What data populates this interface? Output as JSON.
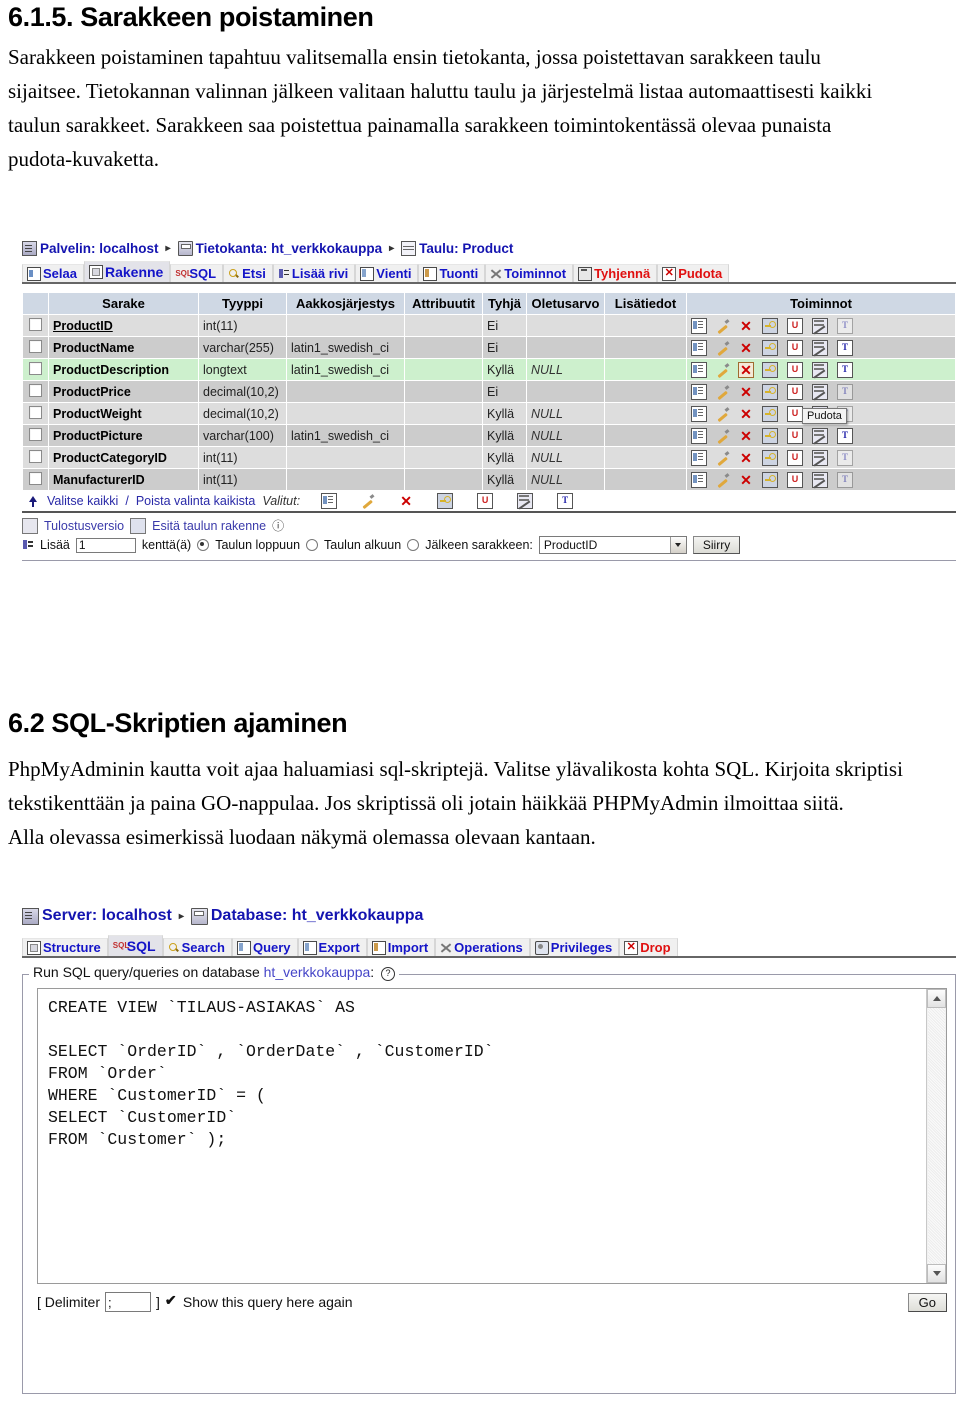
{
  "doc": {
    "section_615": {
      "heading": "6.1.5. Sarakkeen poistaminen",
      "body": "Sarakkeen poistaminen tapahtuu valitsemalla ensin tietokanta, jossa poistettavan sarakkeen taulu sijaitsee. Tietokannan valinnan jälkeen valitaan haluttu taulu ja järjestelmä listaa automaattisesti kaikki taulun sarakkeet. Sarakkeen saa poistettua painamalla sarakkeen toimintokentässä olevaa punaista pudota-kuvaketta."
    },
    "section_62": {
      "heading": "6.2 SQL-Skriptien ajaminen",
      "body": "PhpMyAdminin kautta voit ajaa haluamiasi sql-skriptejä. Valitse ylävalikosta kohta SQL. Kirjoita skriptisi tekstikenttään ja paina GO-nappulaa. Jos skriptissä oli jotain häikkää PHPMyAdmin ilmoittaa siitä.\nAlla olevassa esimerkissä luodaan näkymä olemassa olevaan kantaan."
    }
  },
  "screenshot_structure": {
    "breadcrumb": {
      "server_label": "Palvelin: localhost",
      "database_label": "Tietokanta: ht_verkkokauppa",
      "table_label": "Taulu: Product",
      "separator": "▸"
    },
    "tabs": [
      {
        "label": "Selaa",
        "icon": "browse-icon",
        "active": false,
        "danger": false
      },
      {
        "label": "Rakenne",
        "icon": "structure-icon",
        "active": true,
        "danger": false
      },
      {
        "label": "SQL",
        "icon": "sql-icon",
        "active": false,
        "danger": false
      },
      {
        "label": "Etsi",
        "icon": "search-icon",
        "active": false,
        "danger": false
      },
      {
        "label": "Lisää rivi",
        "icon": "insert-icon",
        "active": false,
        "danger": false
      },
      {
        "label": "Vienti",
        "icon": "export-icon",
        "active": false,
        "danger": false
      },
      {
        "label": "Tuonti",
        "icon": "import-icon",
        "active": false,
        "danger": false
      },
      {
        "label": "Toiminnot",
        "icon": "operations-icon",
        "active": false,
        "danger": false
      },
      {
        "label": "Tyhjennä",
        "icon": "empty-icon",
        "active": false,
        "danger": true
      },
      {
        "label": "Pudota",
        "icon": "drop-icon",
        "active": false,
        "danger": true
      }
    ],
    "table_headers": [
      "",
      "Sarake",
      "Tyyppi",
      "Aakkosjärjestys",
      "Attribuutit",
      "Tyhjä",
      "Oletusarvo",
      "Lisätiedot",
      "Toiminnot"
    ],
    "rows": [
      {
        "name": "ProductID",
        "primary": true,
        "type": "int(11)",
        "collation": "",
        "attributes": "",
        "null": "Ei",
        "default": "",
        "extra": "",
        "highlight": false,
        "shade": "odd"
      },
      {
        "name": "ProductName",
        "primary": false,
        "type": "varchar(255)",
        "collation": "latin1_swedish_ci",
        "attributes": "",
        "null": "Ei",
        "default": "",
        "extra": "",
        "highlight": false,
        "shade": "even"
      },
      {
        "name": "ProductDescription",
        "primary": false,
        "type": "longtext",
        "collation": "latin1_swedish_ci",
        "attributes": "",
        "null": "Kyllä",
        "default": "NULL",
        "extra": "",
        "highlight": true,
        "shade": "hl"
      },
      {
        "name": "ProductPrice",
        "primary": false,
        "type": "decimal(10,2)",
        "collation": "",
        "attributes": "",
        "null": "Ei",
        "default": "",
        "extra": "",
        "highlight": false,
        "shade": "even"
      },
      {
        "name": "ProductWeight",
        "primary": false,
        "type": "decimal(10,2)",
        "collation": "",
        "attributes": "",
        "null": "Kyllä",
        "default": "NULL",
        "extra": "",
        "highlight": false,
        "shade": "odd"
      },
      {
        "name": "ProductPicture",
        "primary": false,
        "type": "varchar(100)",
        "collation": "latin1_swedish_ci",
        "attributes": "",
        "null": "Kyllä",
        "default": "NULL",
        "extra": "",
        "highlight": false,
        "shade": "even"
      },
      {
        "name": "ProductCategoryID",
        "primary": false,
        "type": "int(11)",
        "collation": "",
        "attributes": "",
        "null": "Kyllä",
        "default": "NULL",
        "extra": "",
        "highlight": false,
        "shade": "odd"
      },
      {
        "name": "ManufacturerID",
        "primary": false,
        "type": "int(11)",
        "collation": "",
        "attributes": "",
        "null": "Kyllä",
        "default": "NULL",
        "extra": "",
        "highlight": false,
        "shade": "even"
      }
    ],
    "row_action_icons": [
      "browse-icon",
      "edit-pencil-icon",
      "drop-x-icon",
      "primary-key-icon",
      "unique-icon",
      "index-icon",
      "fulltext-icon"
    ],
    "tooltip": "Pudota",
    "select_bar": {
      "select_all": "Valitse kaikki",
      "divider": "/",
      "deselect_all": "Poista valinta kaikista",
      "with_selected": "Valitut:"
    },
    "footer_links": {
      "print_view": "Tulostusversio",
      "propose_structure": "Esitä taulun rakenne",
      "help": "ⓘ"
    },
    "add_field_row": {
      "add_label": "Lisää",
      "count_value": "1",
      "field_label": "kenttä(ä)",
      "option_end": "Taulun loppuun",
      "option_begin": "Taulun alkuun",
      "option_after": "Jälkeen sarakkeen:",
      "selected_column": "ProductID",
      "go_button": "Siirry"
    }
  },
  "screenshot_sql": {
    "breadcrumb": {
      "server_label": "Server: localhost",
      "database_label": "Database: ht_verkkokauppa",
      "separator": "▸"
    },
    "tabs": [
      {
        "label": "Structure",
        "icon": "structure-icon",
        "active": false,
        "danger": false
      },
      {
        "label": "SQL",
        "icon": "sql-icon",
        "active": true,
        "danger": false
      },
      {
        "label": "Search",
        "icon": "search-icon",
        "active": false,
        "danger": false
      },
      {
        "label": "Query",
        "icon": "query-icon",
        "active": false,
        "danger": false
      },
      {
        "label": "Export",
        "icon": "export-icon",
        "active": false,
        "danger": false
      },
      {
        "label": "Import",
        "icon": "import-icon",
        "active": false,
        "danger": false
      },
      {
        "label": "Operations",
        "icon": "operations-icon",
        "active": false,
        "danger": false
      },
      {
        "label": "Privileges",
        "icon": "privileges-icon",
        "active": false,
        "danger": false
      },
      {
        "label": "Drop",
        "icon": "drop-icon",
        "active": false,
        "danger": true
      }
    ],
    "legend_prefix": "Run SQL query/queries on database",
    "legend_db": "ht_verkkokauppa",
    "legend_suffix": ":",
    "query_text": "CREATE VIEW `TILAUS-ASIAKAS` AS\n\nSELECT `OrderID` , `OrderDate` , `CustomerID`\nFROM `Order`\nWHERE `CustomerID` = (\nSELECT `CustomerID`\nFROM `Customer` );",
    "footer": {
      "delimiter_open": "[ Delimiter",
      "delimiter_value": ";",
      "delimiter_close": "]",
      "show_query_label": "Show this query here again",
      "go_button": "Go"
    }
  },
  "colors": {
    "link_blue": "#2222aa",
    "danger_red": "#e01010",
    "header_bg": "#cfd8e4",
    "row_odd": "#dddddd",
    "row_even": "#cccccc",
    "row_highlight": "#cdf0cd"
  }
}
